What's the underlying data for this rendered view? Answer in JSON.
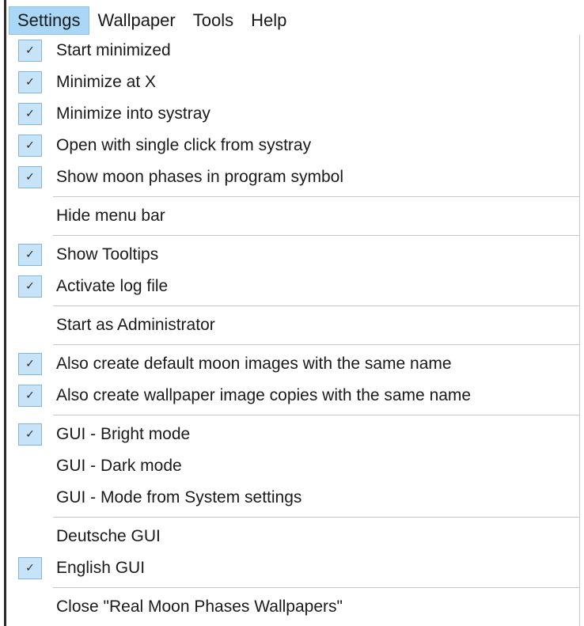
{
  "menubar": {
    "items": [
      {
        "label": "Settings",
        "active": true
      },
      {
        "label": "Wallpaper",
        "active": false
      },
      {
        "label": "Tools",
        "active": false
      },
      {
        "label": "Help",
        "active": false
      }
    ]
  },
  "menu": {
    "groups": [
      [
        {
          "label": "Start minimized",
          "checked": true
        },
        {
          "label": "Minimize at X",
          "checked": true
        },
        {
          "label": "Minimize into systray",
          "checked": true
        },
        {
          "label": "Open with single click from systray",
          "checked": true
        },
        {
          "label": "Show moon phases in program symbol",
          "checked": true
        }
      ],
      [
        {
          "label": "Hide menu bar",
          "checked": false
        }
      ],
      [
        {
          "label": "Show Tooltips",
          "checked": true
        },
        {
          "label": "Activate log file",
          "checked": true
        }
      ],
      [
        {
          "label": "Start as Administrator",
          "checked": false
        }
      ],
      [
        {
          "label": "Also create default moon images with the same name",
          "checked": true
        },
        {
          "label": "Also create wallpaper image copies with the same name",
          "checked": true
        }
      ],
      [
        {
          "label": "GUI - Bright mode",
          "checked": true
        },
        {
          "label": "GUI - Dark mode",
          "checked": false
        },
        {
          "label": "GUI - Mode from System settings",
          "checked": false
        }
      ],
      [
        {
          "label": "Deutsche GUI",
          "checked": false
        },
        {
          "label": "English GUI",
          "checked": true
        }
      ],
      [
        {
          "label": "Close \"Real Moon Phases Wallpapers\"",
          "checked": false
        }
      ]
    ]
  },
  "icons": {
    "checkmark": "✓"
  },
  "colors": {
    "menubar_active": "#a9d7f5",
    "check_bg": "#c7e3f7",
    "check_border": "#7fb6de",
    "separator": "#c8c8c8"
  }
}
